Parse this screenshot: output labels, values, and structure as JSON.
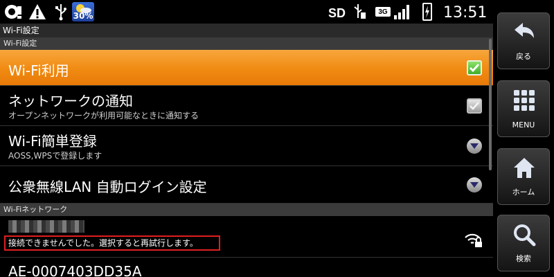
{
  "status_bar": {
    "icons": [
      "sync-alert-icon",
      "warning-icon",
      "usb-icon",
      "weather-icon",
      "sd-card",
      "usb-debug-icon",
      "3g-icon",
      "signal-icon",
      "battery-charging-icon"
    ],
    "weather_percent": "30%",
    "sd_label": "SD",
    "network_label": "3G",
    "time": "13:51"
  },
  "titlebar": {
    "title": "Wi-Fi設定"
  },
  "sections": {
    "settings_header": "Wi-Fi設定",
    "network_header": "Wi-Fiネットワーク"
  },
  "items": {
    "wifi_use": {
      "title": "Wi-Fi利用",
      "checked": true
    },
    "network_notify": {
      "title": "ネットワークの通知",
      "subtitle": "オープンネットワークが利用可能なときに通知する",
      "checked": false
    },
    "easy_register": {
      "title": "Wi-Fi簡単登録",
      "subtitle": "AOSS,WPSで登録します"
    },
    "public_lan": {
      "title": "公衆無線LAN 自動ログイン設定"
    }
  },
  "networks": [
    {
      "ssid_redacted": true,
      "status": "接続できませんでした。選択すると再試行します。",
      "icon": "wifi-locked-icon"
    },
    {
      "ssid": "AE-0007403DD35A"
    }
  ],
  "side_panel": {
    "back": "戻る",
    "menu": "MENU",
    "home": "ホーム",
    "search": "検索"
  },
  "colors": {
    "highlight": "#f08b12",
    "error_border": "#e01f1f",
    "section_header": "#3b3b3b"
  }
}
